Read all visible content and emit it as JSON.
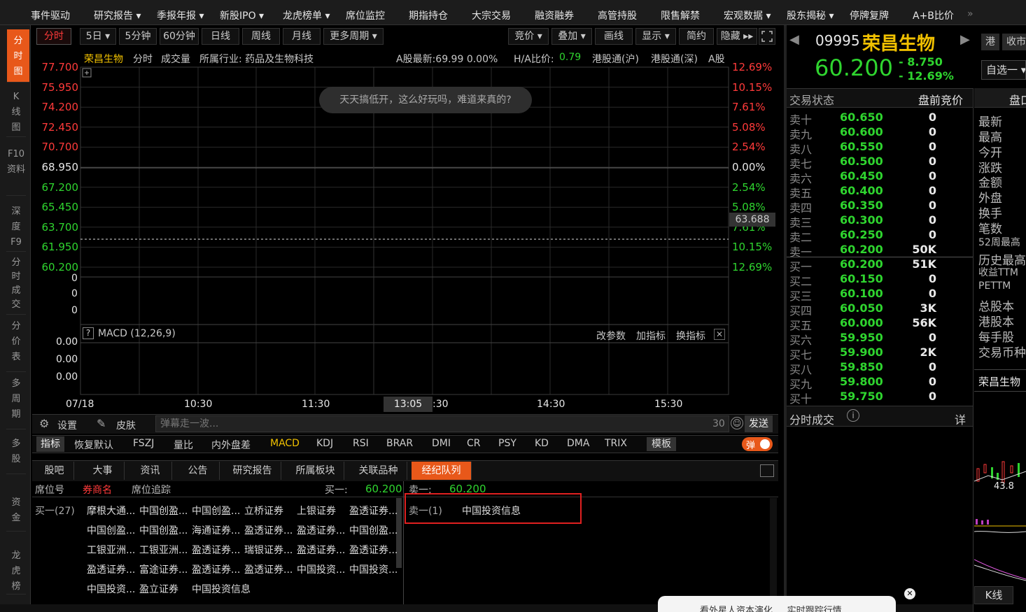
{
  "top_menu": {
    "items": [
      "事件驱动",
      "研究报告 ▾",
      "季报年报 ▾",
      "新股IPO ▾",
      "龙虎榜单 ▾",
      "席位监控",
      "期指持仓",
      "大宗交易",
      "融资融券",
      "高管持股",
      "限售解禁",
      "宏观数据 ▾",
      "股东揭秘 ▾",
      "停牌复牌",
      "A+B比价"
    ],
    "more": "»"
  },
  "left_nav": [
    "分时图",
    "K线图",
    "F10资料",
    "深度F9",
    "分时成交",
    "分价表",
    "多周期",
    "多股",
    "资金",
    "龙虎榜"
  ],
  "chart_toolbar": {
    "periods": [
      "分时",
      "5日 ▾",
      "5分钟",
      "60分钟",
      "日线",
      "周线",
      "月线",
      "更多周期 ▾"
    ],
    "right": [
      "竞价 ▾",
      "叠加 ▾",
      "画线",
      "显示 ▾",
      "简约",
      "隐藏 ▸▸"
    ]
  },
  "info_bar": {
    "name": "荣昌生物",
    "mode": "分时",
    "volume": "成交量",
    "industry": "所属行业: 药品及生物科技",
    "a_share": "A股最新:69.99  0.00%",
    "ha_ratio_label": "H/A比价:",
    "ha_ratio": "0.79",
    "hk_sh": "港股通(沪)",
    "hk_sz": "港股通(深)",
    "a_tab": "A股"
  },
  "chart_data": {
    "type": "line",
    "title": "",
    "y_left": [
      "77.700",
      "75.950",
      "74.200",
      "72.450",
      "70.700",
      "68.950",
      "67.200",
      "65.450",
      "63.700",
      "61.950",
      "60.200"
    ],
    "y_right": [
      "12.69%",
      "10.15%",
      "7.61%",
      "5.08%",
      "2.54%",
      "0.00%",
      "2.54%",
      "5.08%",
      "7.61%",
      "10.15%",
      "12.69%"
    ],
    "prev_close": "68.950",
    "cursor_price": "63.688",
    "x_ticks": [
      "07/18",
      "10:30",
      "11:30",
      "13:05",
      "14:30",
      "15:30"
    ],
    "cursor_time": "13:05",
    "volume_axis": [
      "0",
      "0",
      "0"
    ],
    "macd_axis": [
      "0.00",
      "0.00",
      "0.00"
    ],
    "series": []
  },
  "tooltip": "天天搞低开，这么好玩吗，难道来真的?",
  "macd": {
    "help": "?",
    "label": "MACD (12,26,9)",
    "btns": [
      "改参数",
      "加指标",
      "换指标"
    ]
  },
  "danmu": {
    "settings": "设置",
    "skin": "皮肤",
    "placeholder": "弹幕走一波...",
    "count": "30",
    "send": "发送"
  },
  "indicator_bar": {
    "label": "指标",
    "items": [
      "恢复默认",
      "FSZJ",
      "量比",
      "内外盘差",
      "MACD",
      "KDJ",
      "RSI",
      "BRAR",
      "DMI",
      "CR",
      "PSY",
      "KD",
      "DMA",
      "TRIX"
    ],
    "template": "模板",
    "toggle": "弹"
  },
  "bottom_tabs": [
    "股吧",
    "大事",
    "资讯",
    "公告",
    "研究报告",
    "所属板块",
    "关联品种",
    "经纪队列"
  ],
  "broker": {
    "col1": "席位号",
    "col2": "券商名",
    "col3": "席位追踪",
    "buy1_label": "买一:",
    "buy1_price": "60.200",
    "sell1_label": "卖一:",
    "sell1_price": "60.200",
    "buy_label": "买一(27)",
    "buy_rows": [
      [
        "摩根大通...",
        "中国创盈...",
        "中国创盈...",
        "立桥证券",
        "上银证券",
        "盈透证券..."
      ],
      [
        "中国创盈...",
        "中国创盈...",
        "海通证券...",
        "盈透证券...",
        "盈透证券...",
        "中国创盈..."
      ],
      [
        "工银亚洲...",
        "工银亚洲...",
        "盈透证券...",
        "瑞银证券...",
        "盈透证券...",
        "盈透证券..."
      ],
      [
        "盈透证券...",
        "富途证券...",
        "盈透证券...",
        "盈透证券...",
        "中国投资...",
        "中国投资..."
      ],
      [
        "中国投资...",
        "盈立证券",
        "中国投资信息",
        "",
        "",
        ""
      ]
    ],
    "sell_label": "卖一(1)",
    "sell_rows": [
      [
        "中国投资信息"
      ]
    ]
  },
  "quote": {
    "code": "09995",
    "name": "荣昌生物",
    "market": "港",
    "market2": "收市",
    "price": "60.200",
    "change": "- 8.750",
    "pct": "- 12.69%",
    "watch": "自选一"
  },
  "orderbook": {
    "status_label": "交易状态",
    "status": "盘前竞价",
    "sell": [
      [
        "卖十",
        "60.650",
        "0"
      ],
      [
        "卖九",
        "60.600",
        "0"
      ],
      [
        "卖八",
        "60.550",
        "0"
      ],
      [
        "卖七",
        "60.500",
        "0"
      ],
      [
        "卖六",
        "60.450",
        "0"
      ],
      [
        "卖五",
        "60.400",
        "0"
      ],
      [
        "卖四",
        "60.350",
        "0"
      ],
      [
        "卖三",
        "60.300",
        "0"
      ],
      [
        "卖二",
        "60.250",
        "0"
      ],
      [
        "卖一",
        "60.200",
        "50K"
      ]
    ],
    "buy": [
      [
        "买一",
        "60.200",
        "51K"
      ],
      [
        "买二",
        "60.150",
        "0"
      ],
      [
        "买三",
        "60.100",
        "0"
      ],
      [
        "买四",
        "60.050",
        "3K"
      ],
      [
        "买五",
        "60.000",
        "56K"
      ],
      [
        "买六",
        "59.950",
        "0"
      ],
      [
        "买七",
        "59.900",
        "2K"
      ],
      [
        "买八",
        "59.850",
        "0"
      ],
      [
        "买九",
        "59.800",
        "0"
      ],
      [
        "买十",
        "59.750",
        "0"
      ]
    ],
    "ticks_label": "分时成交",
    "detail": "详"
  },
  "right_panel": {
    "header": "盘口",
    "labels": [
      "最新",
      "最高",
      "今开",
      "涨跌",
      "金额",
      "外盘",
      "换手",
      "笔数",
      "52周最高",
      "历史最高",
      "收益TTM",
      "PETTM",
      "总股本",
      "港股本",
      "每手股",
      "交易币种"
    ],
    "stock": "荣昌生物",
    "kline": "K线",
    "mini_price": "43.8"
  },
  "footer_ad": "看外星人资本演化 ... 实时跟踪行情"
}
